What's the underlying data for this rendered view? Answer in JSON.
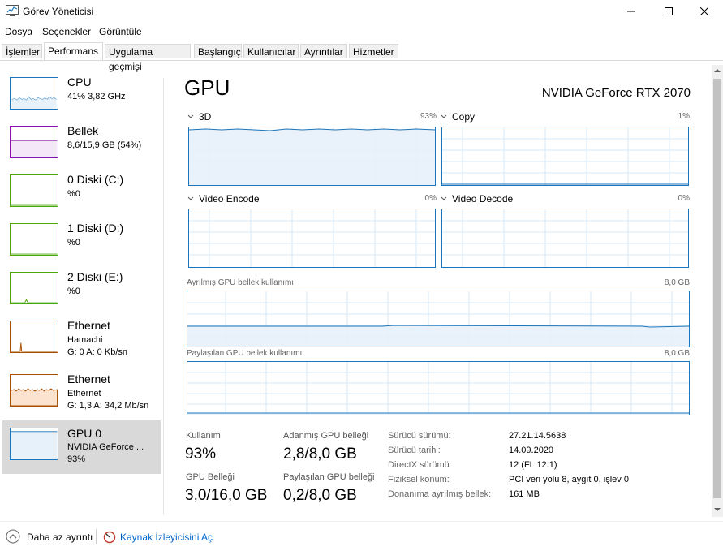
{
  "window": {
    "title": "Görev Yöneticisi",
    "colors": {
      "accent": "#1b75bc",
      "memory": "#8b12ae",
      "disk": "#4da60c",
      "ethernet": "#a74f01",
      "selected": "#d9d9d9"
    }
  },
  "menu": [
    "Dosya",
    "Seçenekler",
    "Görüntüle"
  ],
  "tabs": [
    "İşlemler",
    "Performans",
    "Uygulama geçmişi",
    "Başlangıç",
    "Kullanıcılar",
    "Ayrıntılar",
    "Hizmetler"
  ],
  "active_tab": "Performans",
  "sidebar": [
    {
      "name": "CPU",
      "sub1": "41% 3,82 GHz",
      "sub2": ""
    },
    {
      "name": "Bellek",
      "sub1": "8,6/15,9 GB (54%)",
      "sub2": ""
    },
    {
      "name": "0 Diski (C:)",
      "sub1": "%0",
      "sub2": ""
    },
    {
      "name": "1 Diski (D:)",
      "sub1": "%0",
      "sub2": ""
    },
    {
      "name": "2 Diski (E:)",
      "sub1": "%0",
      "sub2": ""
    },
    {
      "name": "Ethernet",
      "sub1": "Hamachi",
      "sub2": "G: 0 A: 0 Kb/sn"
    },
    {
      "name": "Ethernet",
      "sub1": "Ethernet",
      "sub2": "G: 1,3  A: 34,2 Mb/sn"
    },
    {
      "name": "GPU 0",
      "sub1": "NVIDIA GeForce ...",
      "sub2": "93%"
    }
  ],
  "main": {
    "title": "GPU",
    "model": "NVIDIA GeForce RTX 2070",
    "engines": [
      {
        "name": "3D",
        "percent": "93%"
      },
      {
        "name": "Copy",
        "percent": "1%"
      },
      {
        "name": "Video Encode",
        "percent": "0%"
      },
      {
        "name": "Video Decode",
        "percent": "0%"
      }
    ],
    "dedicated_label": "Ayrılmış GPU bellek kullanımı",
    "dedicated_max": "8,0 GB",
    "shared_label": "Paylaşılan GPU bellek kullanımı",
    "shared_max": "8,0 GB"
  },
  "stats": {
    "usage_label": "Kullanım",
    "usage_value": "93%",
    "dedicated_label": "Adanmış GPU belleği",
    "dedicated_value": "2,8/8,0 GB",
    "gpu_mem_label": "GPU Belleği",
    "gpu_mem_value": "3,0/16,0 GB",
    "shared_label": "Paylaşılan GPU belleği",
    "shared_value": "0,2/8,0 GB"
  },
  "info": [
    {
      "label": "Sürücü sürümü:",
      "value": "27.21.14.5638"
    },
    {
      "label": "Sürücü tarihi:",
      "value": "14.09.2020"
    },
    {
      "label": "DirectX sürümü:",
      "value": "12 (FL 12.1)"
    },
    {
      "label": "Fiziksel konum:",
      "value": "PCI veri yolu 8, aygıt 0, işlev 0"
    },
    {
      "label": "Donanıma ayrılmış bellek:",
      "value": "161 MB"
    }
  ],
  "footer": {
    "less_details": "Daha az ayrıntı",
    "resource_monitor": "Kaynak İzleyicisini Aç"
  }
}
